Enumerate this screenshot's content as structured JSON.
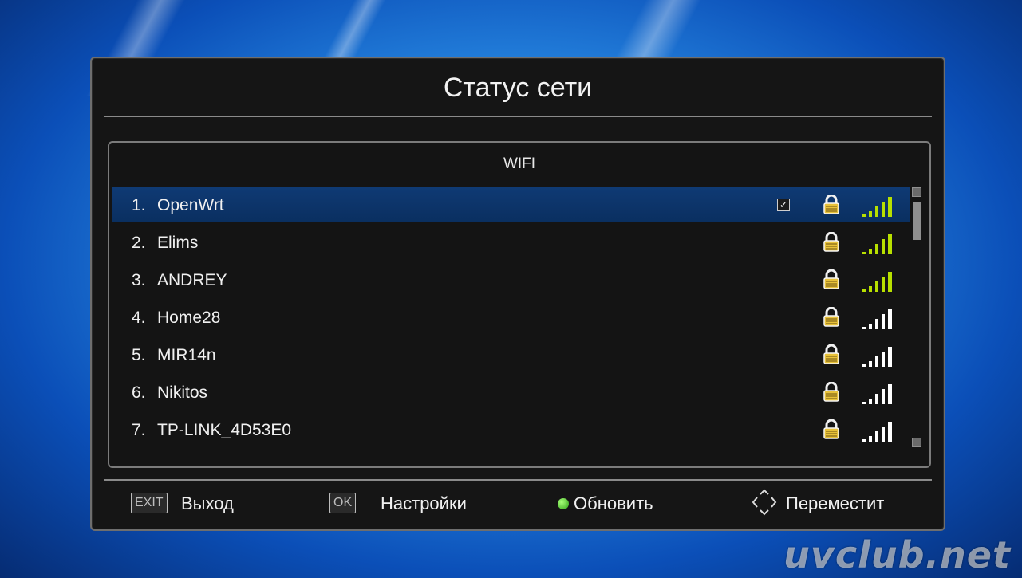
{
  "dialog": {
    "title": "Статус сети"
  },
  "list": {
    "header": "WIFI",
    "items": [
      {
        "num": "1.",
        "name": "OpenWrt",
        "connected": true,
        "secured": true,
        "signal_color": "#b8e000"
      },
      {
        "num": "2.",
        "name": "Elims",
        "connected": false,
        "secured": true,
        "signal_color": "#b8e000"
      },
      {
        "num": "3.",
        "name": "ANDREY",
        "connected": false,
        "secured": true,
        "signal_color": "#b8e000"
      },
      {
        "num": "4.",
        "name": "Home28",
        "connected": false,
        "secured": true,
        "signal_color": "#ffffff"
      },
      {
        "num": "5.",
        "name": "MIR14n",
        "connected": false,
        "secured": true,
        "signal_color": "#ffffff"
      },
      {
        "num": "6.",
        "name": "Nikitos",
        "connected": false,
        "secured": true,
        "signal_color": "#ffffff"
      },
      {
        "num": "7.",
        "name": "TP-LINK_4D53E0",
        "connected": false,
        "secured": true,
        "signal_color": "#ffffff"
      }
    ]
  },
  "footer": {
    "exit_key": "EXIT",
    "exit_label": "Выход",
    "ok_key": "OK",
    "ok_label": "Настройки",
    "refresh_label": "Обновить",
    "move_label": "Переместит"
  },
  "watermark": "uvclub.net",
  "colors": {
    "selected_row": "#0f3a74",
    "signal_strong": "#b8e000",
    "refresh_dot": "#34b51a"
  }
}
